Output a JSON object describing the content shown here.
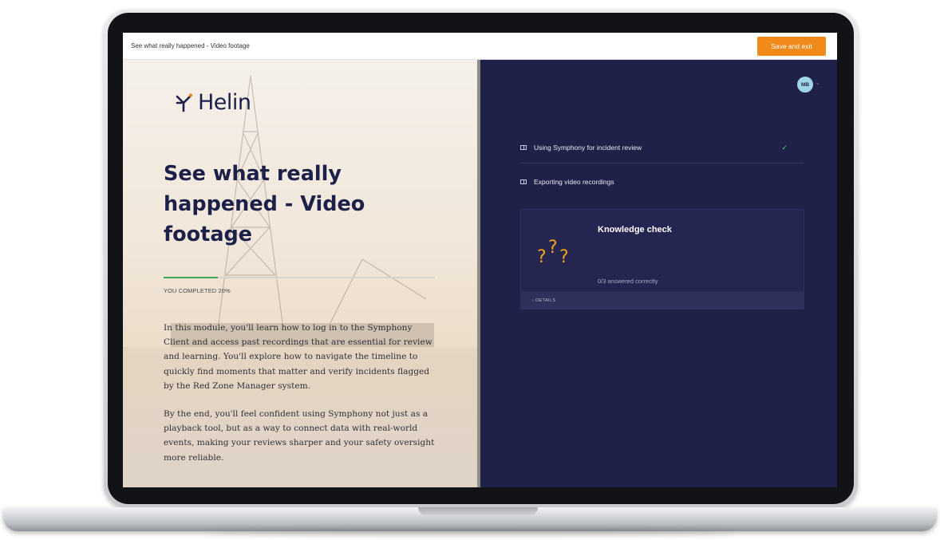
{
  "colors": {
    "accent_orange": "#f28a1b",
    "navy": "#1f2148",
    "progress_green": "#3caa5a",
    "check_green": "#5ccf76"
  },
  "topbar": {
    "title": "See what really happened - Video footage",
    "save_label": "Save and exit"
  },
  "left": {
    "logo": {
      "text": "Helin",
      "icon": "helin-logo-mark"
    },
    "module_title": "See what really happened - Video footage",
    "progress": {
      "percent": 20,
      "label": "YOU COMPLETED 20%"
    },
    "paragraphs": [
      "In this module, you'll learn how to log in to the Symphony Client and access past recordings that are essential for review and learning. You'll explore how to navigate the timeline to quickly find moments that matter and verify incidents flagged by the Red Zone Manager system.",
      "By the end, you'll feel confident using Symphony not just as a playback tool, but as a way to connect data with real-world events, making your reviews sharper and your safety oversight more reliable."
    ]
  },
  "right": {
    "avatar": {
      "initials": "MB",
      "caret": "⌄"
    },
    "lessons": [
      {
        "label": "Using Symphony for incident review",
        "completed": true,
        "check": "✓",
        "icon": "book-icon"
      },
      {
        "label": "Exporting video recordings",
        "completed": false,
        "icon": "book-icon"
      }
    ],
    "knowledge_check": {
      "title": "Knowledge check",
      "status": "0/3 answered correctly",
      "details_label": "› DETAILS",
      "icon": "question-marks-icon"
    }
  }
}
